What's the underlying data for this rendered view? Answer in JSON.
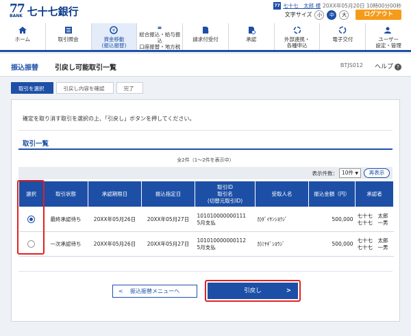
{
  "header": {
    "logo_mark": "77",
    "logo_sub": "BANK",
    "bank_name": "七十七銀行",
    "user_badge": "77",
    "user_name": "七十七　太郎 様",
    "login_time": "20XX年05月20日 10時00分00秒",
    "font_size_label": "文字サイズ",
    "font_sizes": [
      "小",
      "中",
      "大"
    ],
    "logout_label": "ログアウト"
  },
  "nav": {
    "items": [
      {
        "label": "ホーム",
        "icon": "home-icon"
      },
      {
        "label": "取引照会",
        "icon": "list-icon"
      },
      {
        "label": "資金移動\n(振込振替)",
        "icon": "transfer-icon"
      },
      {
        "label": "総合振込・給与振込\n口座振替・地方税",
        "icon": "card-icon"
      },
      {
        "label": "請求付受付",
        "icon": "document-icon"
      },
      {
        "label": "承認",
        "icon": "approve-icon"
      },
      {
        "label": "外部連携・\n各種申込",
        "icon": "link-icon"
      },
      {
        "label": "電子交付",
        "icon": "refresh-icon"
      },
      {
        "label": "ユーザー\n設定・管理",
        "icon": "user-settings-icon"
      }
    ]
  },
  "titlebar": {
    "category": "振込振替",
    "title": "引戻し可能取引一覧",
    "screen_code": "BTJS012",
    "help_label": "ヘルプ",
    "help_icon": "?"
  },
  "steps": [
    "取引を選択",
    "引戻し内容を確認",
    "完了"
  ],
  "instruction": "確定を取り消す取引を選択の上、「引戻し」ボタンを押してください。",
  "list": {
    "section_title": "取引一覧",
    "count_text": "全2件（1～2件を表示中）",
    "per_page_label": "表示件数：",
    "per_page_value": "10件",
    "redisplay_label": "再表示",
    "headers": [
      "選択",
      "取引状態",
      "承認期限日",
      "振込指定日",
      "取引ID\n取引名\n(切替元取引ID)",
      "受取人名",
      "振込金額（円）",
      "承認者"
    ],
    "rows": [
      {
        "selected": true,
        "status": "最終承認待ち",
        "deadline": "20XX年05月26日",
        "transfer_date": "20XX年05月27日",
        "tx_id": "101010000000111",
        "tx_name": "5月支払",
        "recipient": "ｶ)ﾀﾞｲｻﾝｼﾖｳｼﾞ",
        "amount": "500,000",
        "approver1": "七十七　太郎",
        "approver2": "七十七　一男"
      },
      {
        "selected": false,
        "status": "一次承認待ち",
        "deadline": "20XX年05月26日",
        "transfer_date": "20XX年05月27日",
        "tx_id": "101010000000112",
        "tx_name": "5月支払",
        "recipient": "ｶ)ﾐﾔｷﾞｼﾖｳｼﾞ",
        "amount": "500,000",
        "approver1": "七十七　太郎",
        "approver2": "七十七　一男"
      }
    ]
  },
  "buttons": {
    "back_label": "振込振替メニューへ",
    "undo_label": "引戻し"
  },
  "colors": {
    "primary": "#1d4fa6",
    "logout": "#f59b1a",
    "highlight": "#e02020"
  }
}
